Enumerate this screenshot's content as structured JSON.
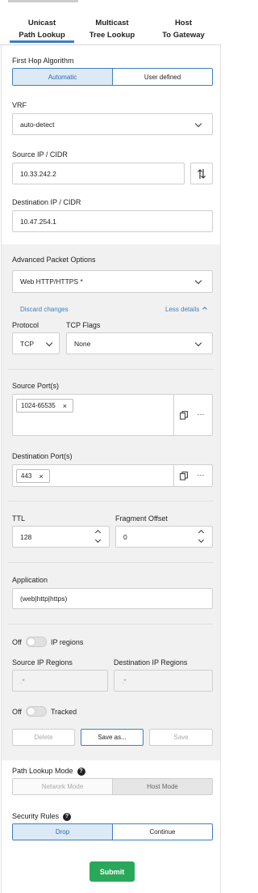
{
  "tabs": [
    {
      "line1": "Unicast",
      "line2": "Path Lookup"
    },
    {
      "line1": "Multicast",
      "line2": "Tree Lookup"
    },
    {
      "line1": "Host",
      "line2": "To Gateway"
    }
  ],
  "first_hop": {
    "label": "First Hop Algorithm",
    "options": [
      "Automatic",
      "User defined"
    ]
  },
  "vrf": {
    "label": "VRF",
    "value": "auto-detect"
  },
  "source_ip": {
    "label": "Source IP / CIDR",
    "value": "10.33.242.2"
  },
  "dest_ip": {
    "label": "Destination IP / CIDR",
    "value": "10.47.254.1"
  },
  "advanced": {
    "label": "Advanced Packet Options",
    "preset": "Web HTTP/HTTPS *",
    "discard": "Discard changes",
    "less": "Less details"
  },
  "protocol": {
    "label": "Protocol",
    "value": "TCP"
  },
  "tcp_flags": {
    "label": "TCP Flags",
    "value": "None"
  },
  "source_ports": {
    "label": "Source Port(s)",
    "chip": "1024-65535"
  },
  "dest_ports": {
    "label": "Destination Port(s)",
    "chip": "443"
  },
  "ttl": {
    "label": "TTL",
    "value": "128"
  },
  "fragment": {
    "label": "Fragment Offset",
    "value": "0"
  },
  "application": {
    "label": "Application",
    "value": "(web|http|https)"
  },
  "ip_regions": {
    "off": "Off",
    "label": "IP regions",
    "source_label": "Source IP Regions",
    "dest_label": "Destination IP Regions",
    "source_placeholder": ".*",
    "dest_placeholder": ".*"
  },
  "tracked": {
    "off": "Off",
    "label": "Tracked"
  },
  "actions": {
    "delete": "Delete",
    "save_as": "Save as...",
    "save": "Save"
  },
  "path_mode": {
    "label": "Path Lookup Mode",
    "options": [
      "Network Mode",
      "Host Mode"
    ]
  },
  "security": {
    "label": "Security Rules",
    "options": [
      "Drop",
      "Continue"
    ]
  },
  "submit": "Submit",
  "colors": {
    "accent": "#3f7ec0",
    "submit": "#2aa85a",
    "panel": "#f1f1f1"
  }
}
